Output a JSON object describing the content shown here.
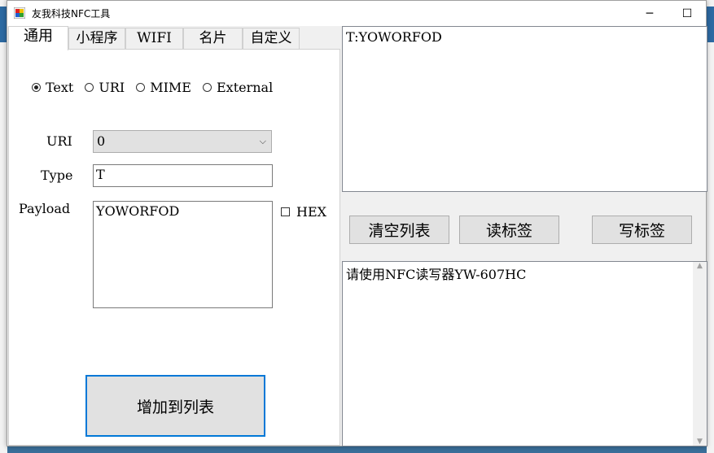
{
  "window": {
    "title": "友我科技NFC工具",
    "minimize": "─",
    "maximize": "☐",
    "close": "✕"
  },
  "tabs": [
    {
      "label": "通用"
    },
    {
      "label": "小程序"
    },
    {
      "label": "WIFI"
    },
    {
      "label": "名片"
    },
    {
      "label": "自定义"
    }
  ],
  "record_types": [
    {
      "label": "Text",
      "selected": true
    },
    {
      "label": "URI",
      "selected": false
    },
    {
      "label": "MIME",
      "selected": false
    },
    {
      "label": "External",
      "selected": false
    }
  ],
  "form": {
    "uri_label": "URI",
    "uri_value": "0",
    "type_label": "Type",
    "type_value": "T",
    "payload_label": "Payload",
    "payload_value": "YOWORFOD",
    "hex_label": "HEX",
    "add_button": "增加到列表"
  },
  "record_list": [
    "T:YOWORFOD"
  ],
  "actions": {
    "clear_list": "清空列表",
    "read_tag": "读标签",
    "write_tag": "写标签"
  },
  "log_text": "请使用NFC读写器YW-607HC",
  "colors": {
    "accent": "#0078d7",
    "button_bg": "#e1e1e1",
    "window_bg": "#f0f0f0"
  }
}
